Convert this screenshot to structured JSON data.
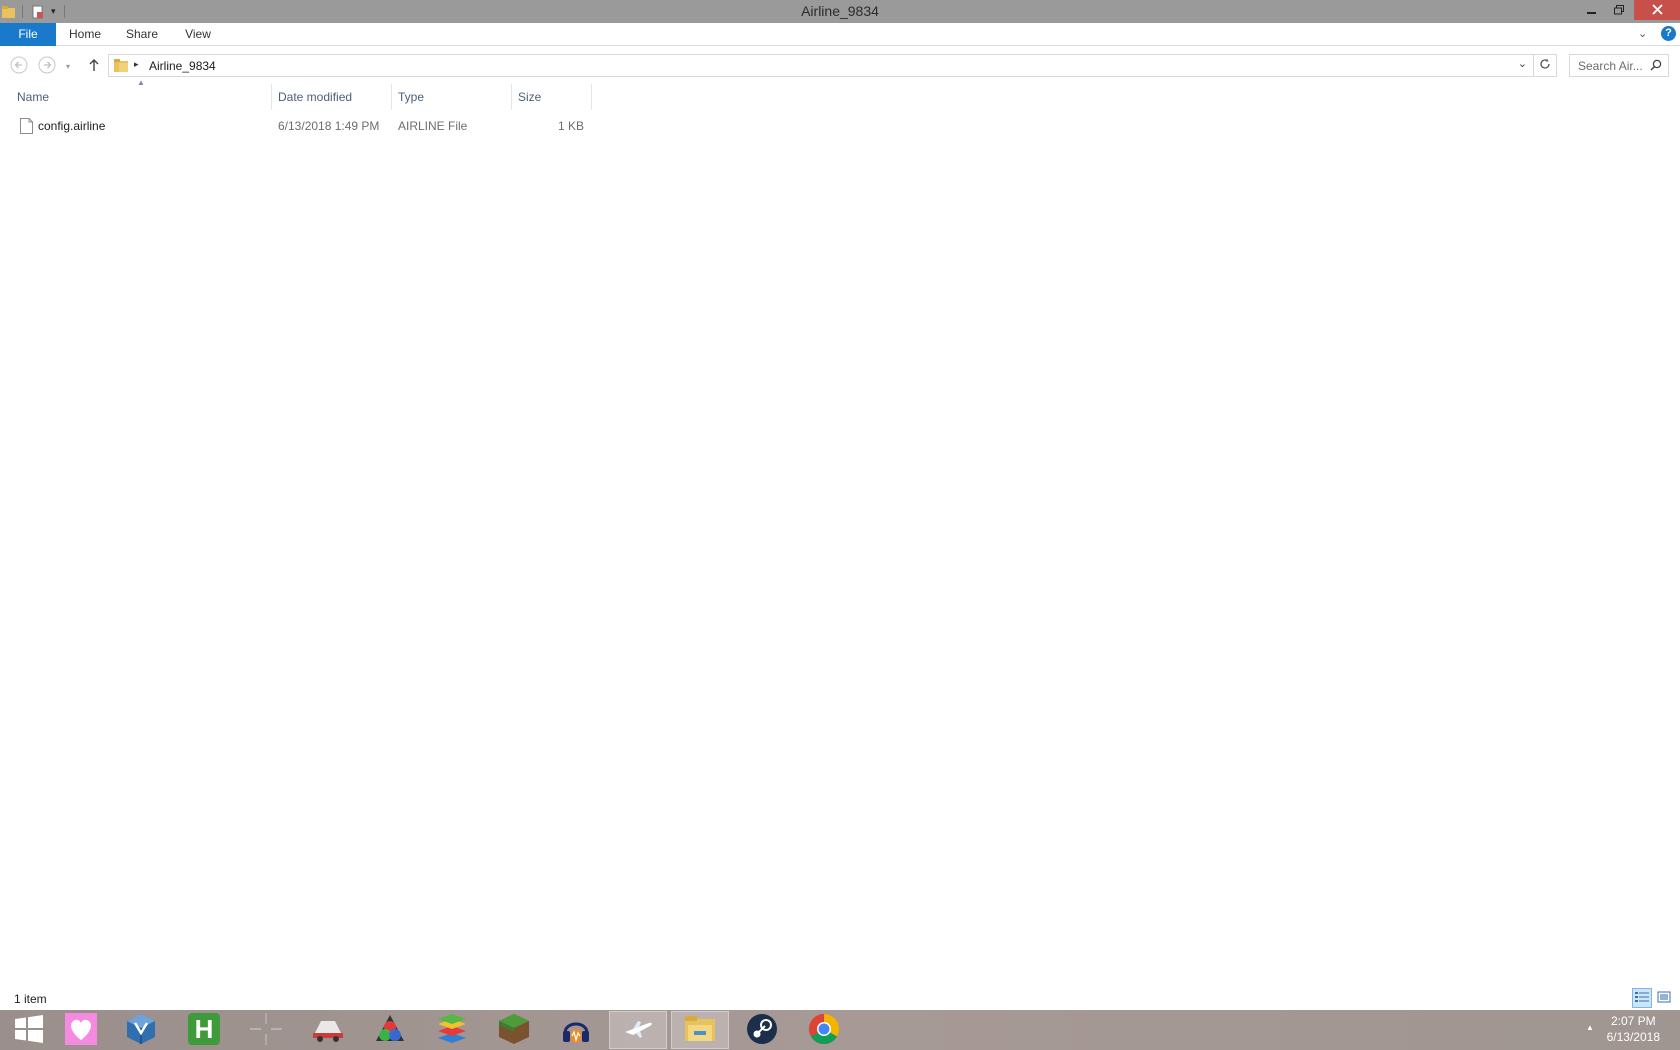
{
  "window": {
    "title": "Airline_9834",
    "minimize_icon": "minimize-icon",
    "restore_icon": "restore-icon",
    "close_icon": "close-icon"
  },
  "ribbon": {
    "tabs": [
      {
        "label": "File"
      },
      {
        "label": "Home"
      },
      {
        "label": "Share"
      },
      {
        "label": "View"
      }
    ]
  },
  "address": {
    "path": "Airline_9834"
  },
  "search": {
    "placeholder": "Search Air..."
  },
  "columns": [
    {
      "label": "Name"
    },
    {
      "label": "Date modified"
    },
    {
      "label": "Type"
    },
    {
      "label": "Size"
    }
  ],
  "files": [
    {
      "name": "config.airline",
      "date": "6/13/2018 1:49 PM",
      "type": "AIRLINE File",
      "size": "1 KB"
    }
  ],
  "status": {
    "item_count": "1 item"
  },
  "taskbar": {
    "apps": [
      "start",
      "heart-app",
      "virtualbox",
      "h-app",
      "crosshair-app",
      "trucking-app",
      "rgb-app",
      "bluestacks",
      "minecraft",
      "audio-app",
      "airline-app",
      "file-explorer",
      "steam",
      "chrome"
    ],
    "time": "2:07 PM",
    "date": "6/13/2018"
  },
  "colors": {
    "accent": "#1979ca",
    "titlebar": "#9a9a9a",
    "close": "#c7504a",
    "header_text": "#4c607a"
  }
}
